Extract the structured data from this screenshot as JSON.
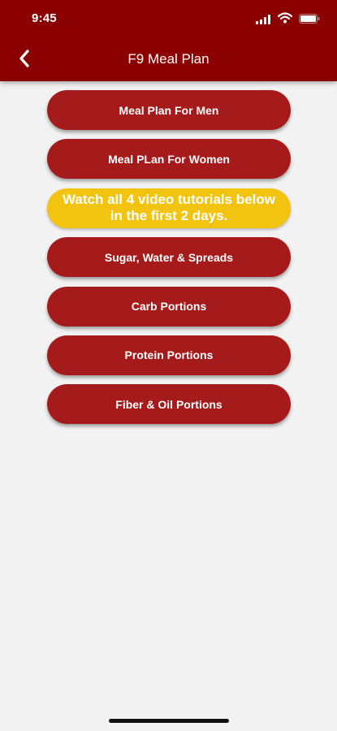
{
  "status_bar": {
    "time": "9:45"
  },
  "nav": {
    "title": "F9 Meal Plan"
  },
  "menu": {
    "items": [
      {
        "label": "Meal Plan For Men"
      },
      {
        "label": "Meal PLan For Women"
      },
      {
        "label": "Watch all 4 video tutorials below in the first 2 days."
      },
      {
        "label": "Sugar, Water & Spreads"
      },
      {
        "label": "Carb Portions"
      },
      {
        "label": "Protein Portions"
      },
      {
        "label": "Fiber & Oil Portions"
      }
    ]
  },
  "colors": {
    "header": "#8b0000",
    "button": "#a51a1a",
    "notice": "#f2c40f",
    "background": "#f2f2f2"
  }
}
